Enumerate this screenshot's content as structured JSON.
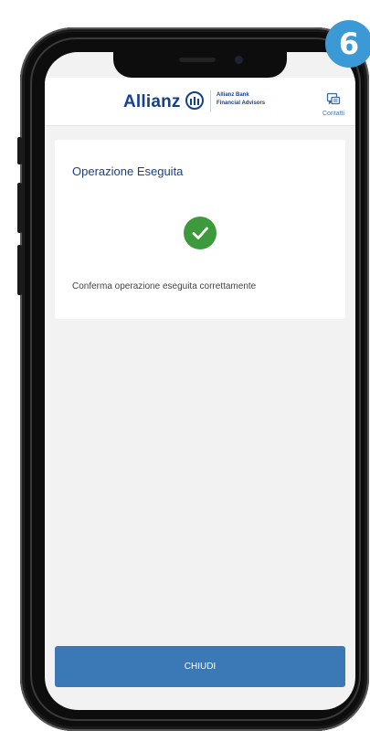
{
  "header": {
    "brand": "Allianz",
    "bank_line_1": "Allianz Bank",
    "bank_line_2": "Financial Advisors",
    "contacts_label": "Contatti",
    "contacts_icon": "chat-bubble-icon",
    "brand_color": "#173f8a"
  },
  "result_card": {
    "title": "Operazione Eseguita",
    "status_icon": "checkmark-icon",
    "message": "Conferma operazione eseguita correttamente",
    "success_color": "#3c9a3c"
  },
  "actions": {
    "close_label": "CHIUDI",
    "button_color": "#3a78b6"
  },
  "step_badge": {
    "number": "6",
    "color": "#3b9ad6"
  }
}
